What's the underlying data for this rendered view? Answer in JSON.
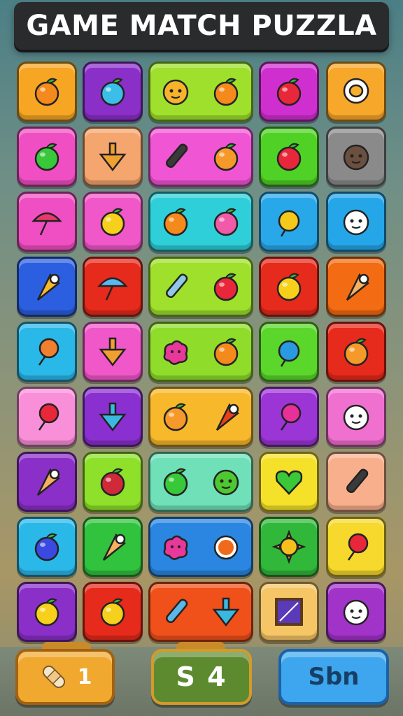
{
  "header": {
    "title": "GAME MATCH PUZZLA"
  },
  "board": {
    "rows": [
      [
        {
          "color": "#f6a623",
          "icons": [
            "orange-icon"
          ]
        },
        {
          "color": "#8b2fc9",
          "icons": [
            "blue-fruit-icon"
          ]
        },
        {
          "color": "#9ee02c",
          "icons": [
            "smiley-blob-icon",
            "orange-icon"
          ],
          "wide": true
        },
        {
          "color": "#d02fd0",
          "icons": [
            "red-apple-icon"
          ]
        },
        {
          "color": "#f7a72a",
          "icons": [
            "egg-speech-icon"
          ]
        }
      ],
      [
        {
          "color": "#f04fc3",
          "icons": [
            "green-apple-icon"
          ]
        },
        {
          "color": "#f5a56e",
          "icons": [
            "spinning-top-icon"
          ]
        },
        {
          "color": "#f056d4",
          "icons": [
            "paint-brush-icon",
            "mango-icon"
          ],
          "wide": true
        },
        {
          "color": "#4fd126",
          "icons": [
            "red-apple-icon"
          ]
        },
        {
          "color": "#8a8a8a",
          "icons": [
            "stone-face-icon"
          ]
        }
      ],
      [
        {
          "color": "#f04fc3",
          "icons": [
            "umbrella-icon"
          ]
        },
        {
          "color": "#f057c8",
          "icons": [
            "yellow-apple-icon"
          ]
        },
        {
          "color": "#2ecfd8",
          "icons": [
            "orange-icon",
            "pink-apple-icon"
          ],
          "wide": true
        },
        {
          "color": "#29a8e9",
          "icons": [
            "yellow-candy-icon"
          ]
        },
        {
          "color": "#25a6e8",
          "icons": [
            "panda-face-icon"
          ]
        }
      ],
      [
        {
          "color": "#2b5fe0",
          "icons": [
            "carrot-icon"
          ]
        },
        {
          "color": "#e62a1b",
          "icons": [
            "umbrella-blue-icon"
          ]
        },
        {
          "color": "#9ee02c",
          "icons": [
            "spray-can-icon",
            "red-apple-icon"
          ],
          "wide": true
        },
        {
          "color": "#e62a1b",
          "icons": [
            "yellow-apple-icon"
          ]
        },
        {
          "color": "#f36b12",
          "icons": [
            "ice-cream-icon"
          ]
        }
      ],
      [
        {
          "color": "#2ab8e8",
          "icons": [
            "orange-lollipop-icon"
          ]
        },
        {
          "color": "#f057c8",
          "icons": [
            "spinning-top-icon"
          ]
        },
        {
          "color": "#8fdc2a",
          "icons": [
            "pink-blob-icon",
            "orange-icon"
          ],
          "wide": true
        },
        {
          "color": "#5bd62a",
          "icons": [
            "blue-potion-icon"
          ]
        },
        {
          "color": "#e62a1b",
          "icons": [
            "mango-icon"
          ]
        }
      ],
      [
        {
          "color": "#f88fd8",
          "icons": [
            "red-lollipop-icon"
          ]
        },
        {
          "color": "#8a2fd0",
          "icons": [
            "blue-top-icon"
          ]
        },
        {
          "color": "#f7b82c",
          "icons": [
            "mango-icon",
            "red-carrot-icon"
          ],
          "wide": true
        },
        {
          "color": "#9b35d6",
          "icons": [
            "pink-lollipop-icon"
          ]
        },
        {
          "color": "#f070d0",
          "icons": [
            "panda-face-icon"
          ]
        }
      ],
      [
        {
          "color": "#8a2fc8",
          "icons": [
            "ice-cream-cone-icon"
          ]
        },
        {
          "color": "#8ee02a",
          "icons": [
            "strawberry-icon"
          ]
        },
        {
          "color": "#6fe0b8",
          "icons": [
            "green-apple-icon",
            "green-face-icon"
          ],
          "wide": true
        },
        {
          "color": "#f5e12a",
          "icons": [
            "green-heart-icon"
          ]
        },
        {
          "color": "#f8b08c",
          "icons": [
            "paint-brush-icon"
          ]
        }
      ],
      [
        {
          "color": "#2ab8e8",
          "icons": [
            "blue-apple-icon"
          ]
        },
        {
          "color": "#31c33e",
          "icons": [
            "ice-cream-icon"
          ]
        },
        {
          "color": "#2a86e0",
          "icons": [
            "pink-blob-icon",
            "orange-slice-icon"
          ],
          "wide": true
        },
        {
          "color": "#31b83a",
          "icons": [
            "sun-icon"
          ]
        },
        {
          "color": "#f7d82c",
          "icons": [
            "red-lollipop-icon"
          ]
        }
      ],
      [
        {
          "color": "#8a2fc8",
          "icons": [
            "yellow-apple-icon"
          ]
        },
        {
          "color": "#e62a1b",
          "icons": [
            "yellow-mango-icon"
          ]
        },
        {
          "color": "#f0501a",
          "icons": [
            "syringe-icon",
            "blue-top-icon"
          ],
          "wide": true
        },
        {
          "color": "#f5c566",
          "icons": [
            "picture-frame-icon"
          ]
        },
        {
          "color": "#a233c8",
          "icons": [
            "panda-face-icon"
          ]
        }
      ]
    ]
  },
  "footer": {
    "powerup_label": "1",
    "score_label": "S 4",
    "spin_label": "Sbn"
  },
  "colors": {
    "orange-icon": "#f58a1c",
    "blue-fruit-icon": "#3bbfe8",
    "smiley-blob-icon": "#f7b32c",
    "red-apple-icon": "#e8283a",
    "egg-speech-icon": "#ffffff",
    "green-apple-icon": "#38c83a",
    "spinning-top-icon": "#f0a030",
    "paint-brush-icon": "#3a3a3a",
    "mango-icon": "#f59a2a",
    "stone-face-icon": "#6b5040",
    "umbrella-icon": "#e83a6a",
    "yellow-apple-icon": "#f7d01c",
    "pink-apple-icon": "#f05aa8",
    "yellow-candy-icon": "#f5c91c",
    "panda-face-icon": "#ffffff",
    "carrot-icon": "#f7b82c",
    "umbrella-blue-icon": "#5ab8f0",
    "spray-can-icon": "#8fc8e8",
    "ice-cream-icon": "#f5b060",
    "orange-lollipop-icon": "#f08030",
    "pink-blob-icon": "#e8389a",
    "blue-potion-icon": "#2a9ae0",
    "red-lollipop-icon": "#e8283a",
    "blue-top-icon": "#3ab8e0",
    "red-carrot-icon": "#e8401a",
    "pink-lollipop-icon": "#e8309a",
    "ice-cream-cone-icon": "#f5b060",
    "strawberry-icon": "#d02a3a",
    "green-face-icon": "#4ec830",
    "green-heart-icon": "#3ac838",
    "blue-apple-icon": "#3a4ae0",
    "orange-slice-icon": "#f06a1a",
    "sun-icon": "#f5c01c",
    "yellow-mango-icon": "#f5d01c",
    "syringe-icon": "#5ab8e8",
    "picture-frame-icon": "#5a3ab8"
  }
}
